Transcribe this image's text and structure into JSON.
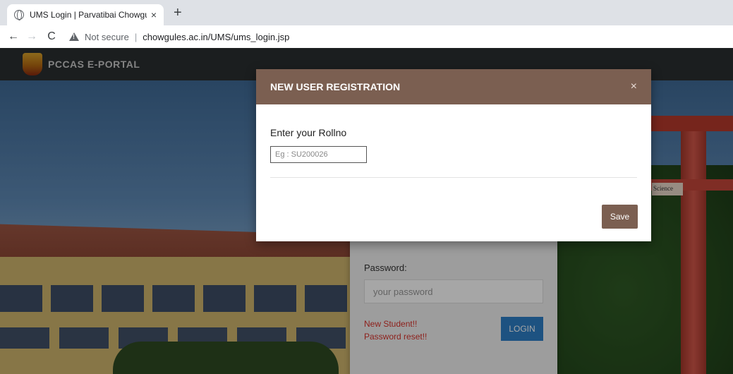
{
  "browser": {
    "tab_title": "UMS Login | Parvatibai Chowgule",
    "tab_close": "×",
    "new_tab": "+",
    "back": "←",
    "forward": "→",
    "reload": "C",
    "security": "Not secure",
    "separator": "|",
    "url": "chowgules.ac.in/UMS/ums_login.jsp"
  },
  "site": {
    "brand": "PCCAS E-PORTAL",
    "sign_text": "Science"
  },
  "login": {
    "password_label": "Password:",
    "password_placeholder": "your password",
    "new_student": "New Student!!",
    "password_reset": "Password reset!!",
    "login_button": "LOGIN"
  },
  "modal": {
    "title": "NEW USER REGISTRATION",
    "close": "×",
    "rollno_label": "Enter your Rollno",
    "rollno_placeholder": "Eg : SU200026",
    "save_button": "Save"
  },
  "colors": {
    "modal_header": "#7b5f51",
    "login_button": "#2d7ec6",
    "link_red": "#d9332c"
  }
}
